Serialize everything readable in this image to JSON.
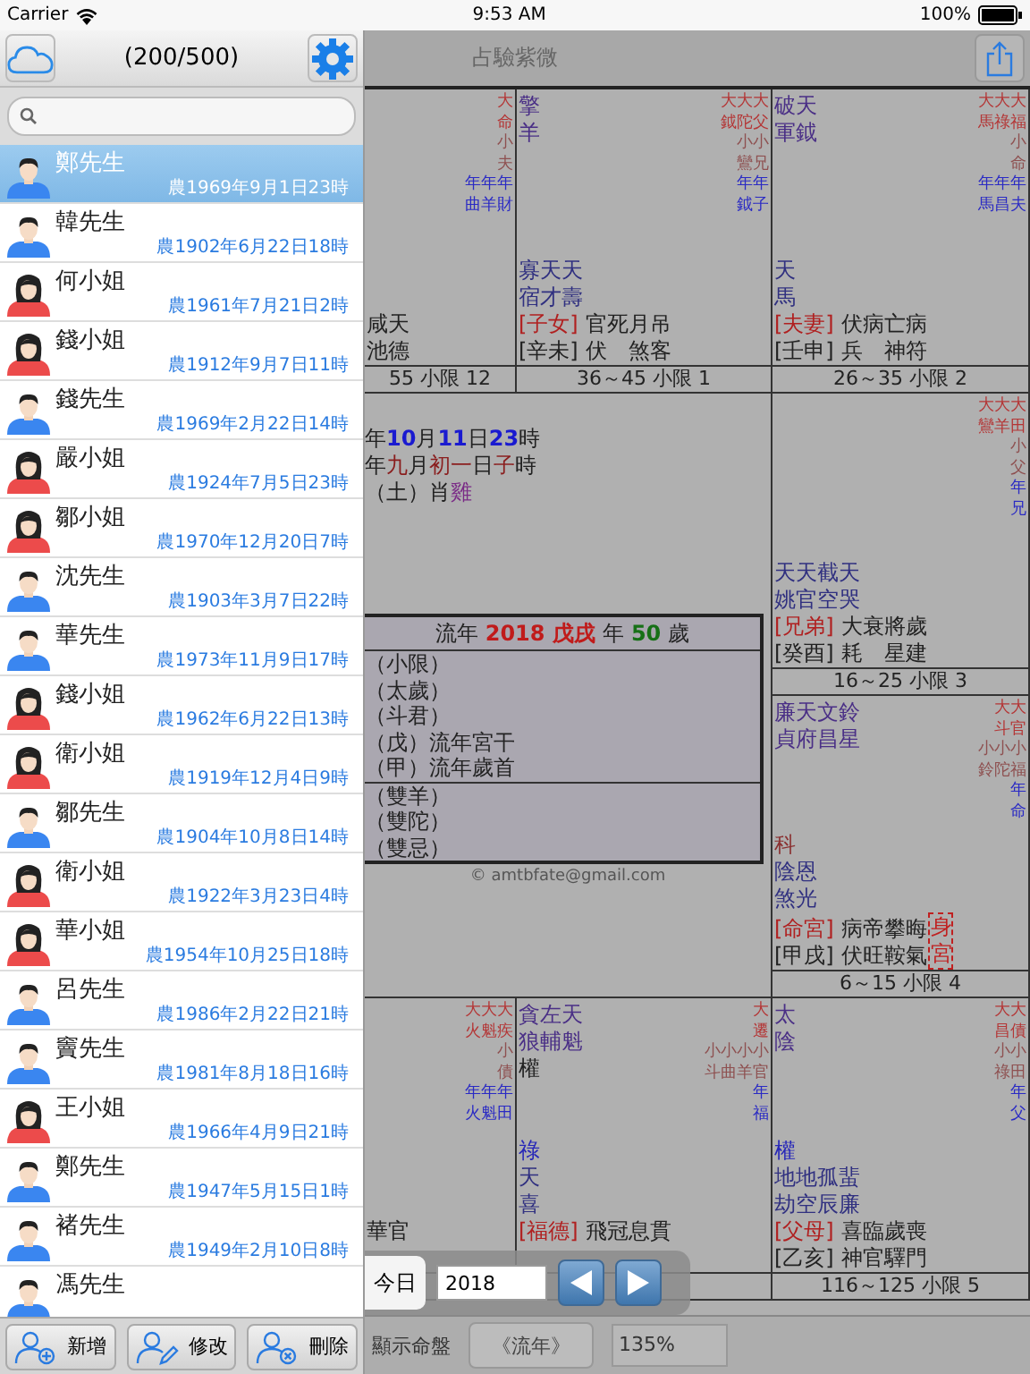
{
  "status_bar": {
    "carrier": "Carrier",
    "time": "9:53 AM",
    "battery": "100%"
  },
  "sidebar": {
    "count": "(200/500)"
  },
  "people": [
    {
      "name": "鄭先生",
      "date": "農1969年9月1日23時",
      "kind": "male",
      "selected": true
    },
    {
      "name": "韓先生",
      "date": "農1902年6月22日18時",
      "kind": "male",
      "selected": false
    },
    {
      "name": "何小姐",
      "date": "農1961年7月21日2時",
      "kind": "female",
      "selected": false
    },
    {
      "name": "錢小姐",
      "date": "農1912年9月7日11時",
      "kind": "female",
      "selected": false
    },
    {
      "name": "錢先生",
      "date": "農1969年2月22日14時",
      "kind": "male",
      "selected": false
    },
    {
      "name": "嚴小姐",
      "date": "農1924年7月5日23時",
      "kind": "female",
      "selected": false
    },
    {
      "name": "鄒小姐",
      "date": "農1970年12月20日7時",
      "kind": "female",
      "selected": false
    },
    {
      "name": "沈先生",
      "date": "農1903年3月7日22時",
      "kind": "male",
      "selected": false
    },
    {
      "name": "華先生",
      "date": "農1973年11月9日17時",
      "kind": "male",
      "selected": false
    },
    {
      "name": "錢小姐",
      "date": "農1962年6月22日13時",
      "kind": "female",
      "selected": false
    },
    {
      "name": "衛小姐",
      "date": "農1919年12月4日9時",
      "kind": "female",
      "selected": false
    },
    {
      "name": "鄒先生",
      "date": "農1904年10月8日14時",
      "kind": "male",
      "selected": false
    },
    {
      "name": "衛小姐",
      "date": "農1922年3月23日4時",
      "kind": "female",
      "selected": false
    },
    {
      "name": "華小姐",
      "date": "農1954年10月25日18時",
      "kind": "female",
      "selected": false
    },
    {
      "name": "呂先生",
      "date": "農1986年2月22日21時",
      "kind": "male",
      "selected": false
    },
    {
      "name": "竇先生",
      "date": "農1981年8月18日16時",
      "kind": "male",
      "selected": false
    },
    {
      "name": "王小姐",
      "date": "農1966年4月9日21時",
      "kind": "female",
      "selected": false
    },
    {
      "name": "鄭先生",
      "date": "農1947年5月15日1時",
      "kind": "male",
      "selected": false
    },
    {
      "name": "褚先生",
      "date": "農1949年2月10日8時",
      "kind": "male",
      "selected": false
    },
    {
      "name": "馮先生",
      "kind": "male",
      "selected": false
    }
  ],
  "list_buttons": [
    {
      "label": "新增",
      "kind": "add"
    },
    {
      "label": "修改",
      "kind": "edit"
    },
    {
      "label": "刪除",
      "kind": "delete"
    }
  ],
  "chart": {
    "title": "占驗紫微",
    "cells": [
      {
        "annotations": [
          {
            "text": "大",
            "kind": "da"
          },
          {
            "text": "命",
            "kind": "da"
          },
          {
            "text": "小",
            "kind": "xiao"
          },
          {
            "text": "夫",
            "kind": "xiao"
          },
          {
            "text": "年年年",
            "kind": "nian"
          },
          {
            "text": "曲羊財",
            "kind": "nian"
          }
        ],
        "palace": {
          "stars": "咸天"
        },
        "stem": {
          "stars": "池德"
        },
        "footer": "55 小限 12"
      },
      {
        "main": [
          {
            "text": "擎",
            "kind": "major"
          },
          {
            "text": "羊",
            "kind": "major"
          }
        ],
        "annotations": [
          {
            "text": "大大大",
            "kind": "da"
          },
          {
            "text": "鉞陀父",
            "kind": "da"
          },
          {
            "text": "小小",
            "kind": "xiao"
          },
          {
            "text": "鸞兄",
            "kind": "xiao"
          },
          {
            "text": "年年",
            "kind": "nian"
          },
          {
            "text": "鉞子",
            "kind": "nian"
          }
        ],
        "lines": [
          {
            "text": "寡天天",
            "kind": "minor"
          },
          {
            "text": "宿才壽",
            "kind": "minor"
          }
        ],
        "palace": {
          "label": "[子女]",
          "stars": "官死月吊"
        },
        "stem": {
          "label": "[辛未]",
          "stars": "伏　煞客"
        },
        "footer": "36～45 小限 1"
      },
      {
        "main": [
          {
            "text": "破天",
            "kind": "major"
          },
          {
            "text": "軍鉞",
            "kind": "major"
          }
        ],
        "annotations": [
          {
            "text": "大大大",
            "kind": "da"
          },
          {
            "text": "馬祿福",
            "kind": "da"
          },
          {
            "text": "小",
            "kind": "xiao"
          },
          {
            "text": "命",
            "kind": "xiao"
          },
          {
            "text": "年年年",
            "kind": "nian"
          },
          {
            "text": "馬昌夫",
            "kind": "nian"
          }
        ],
        "lines": [
          {
            "text": "天",
            "kind": "minor"
          },
          {
            "text": "馬",
            "kind": "minor"
          }
        ],
        "palace": {
          "label": "[夫妻]",
          "stars": "伏病亡病"
        },
        "stem": {
          "label": "[壬申]",
          "stars": "兵　神符"
        },
        "footer": "26～35 小限 2"
      },
      {
        "annotations": [
          {
            "text": "大大大",
            "kind": "da"
          },
          {
            "text": "鸞羊田",
            "kind": "da"
          },
          {
            "text": "小",
            "kind": "xiao"
          },
          {
            "text": "父",
            "kind": "xiao"
          },
          {
            "text": "年",
            "kind": "nian"
          },
          {
            "text": "兄",
            "kind": "nian"
          }
        ],
        "lines": [
          {
            "text": "天天截天",
            "kind": "minor"
          },
          {
            "text": "姚官空哭",
            "kind": "minor"
          }
        ],
        "palace": {
          "label": "[兄弟]",
          "stars": "大衰將歲"
        },
        "stem": {
          "label": "[癸酉]",
          "stars": "耗　星建"
        },
        "footer": "16～25 小限 3"
      },
      {
        "main": [
          {
            "text": "廉天文鈴",
            "kind": "major"
          },
          {
            "text": "貞府昌星",
            "kind": "major"
          }
        ],
        "annotations": [
          {
            "text": "大大",
            "kind": "da"
          },
          {
            "text": "斗官",
            "kind": "da"
          },
          {
            "text": "小小小",
            "kind": "xiao"
          },
          {
            "text": "鈴陀福",
            "kind": "xiao"
          },
          {
            "text": "年",
            "kind": "nian"
          },
          {
            "text": "命",
            "kind": "nian"
          }
        ],
        "lines": [
          {
            "text": "科",
            "kind": "ke"
          },
          {
            "text": "陰恩",
            "kind": "minor"
          },
          {
            "text": "煞光",
            "kind": "minor"
          }
        ],
        "palace": {
          "label": "[命宮]",
          "stars": "病帝攀晦"
        },
        "stem": {
          "label": "[甲戌]",
          "stars": "伏旺鞍氣"
        },
        "body_mark": "身宮",
        "footer": "6～15 小限 4"
      },
      {
        "annotations": [
          {
            "text": "大大大",
            "kind": "da"
          },
          {
            "text": "火魁疾",
            "kind": "da"
          },
          {
            "text": "小",
            "kind": "xiao"
          },
          {
            "text": "債",
            "kind": "xiao"
          },
          {
            "text": "年年年",
            "kind": "nian"
          },
          {
            "text": "火魁田",
            "kind": "nian"
          }
        ],
        "palace": {
          "stars": "華官"
        }
      },
      {
        "main": [
          {
            "text": "貪左天",
            "kind": "major"
          },
          {
            "text": "狼輔魁",
            "kind": "major"
          },
          {
            "text": "權",
            "kind": "quan"
          }
        ],
        "annotations": [
          {
            "text": "大",
            "kind": "da"
          },
          {
            "text": "遷",
            "kind": "da"
          },
          {
            "text": "小小小小",
            "kind": "xiao"
          },
          {
            "text": "斗曲羊官",
            "kind": "xiao"
          },
          {
            "text": "年",
            "kind": "nian"
          },
          {
            "text": "福",
            "kind": "nian"
          }
        ],
        "lines": [
          {
            "text": "祿",
            "kind": "lu"
          },
          {
            "text": "天",
            "kind": "minor"
          },
          {
            "text": "喜",
            "kind": "minor"
          }
        ],
        "palace": {
          "label": "[福德]",
          "stars": "飛冠息貫"
        }
      },
      {
        "main": [
          {
            "text": "太",
            "kind": "major"
          },
          {
            "text": "陰",
            "kind": "major"
          }
        ],
        "annotations": [
          {
            "text": "大大",
            "kind": "da"
          },
          {
            "text": "昌債",
            "kind": "da"
          },
          {
            "text": "小小",
            "kind": "xiao"
          },
          {
            "text": "祿田",
            "kind": "xiao"
          },
          {
            "text": "年",
            "kind": "nian"
          },
          {
            "text": "父",
            "kind": "nian"
          }
        ],
        "lines": [
          {
            "text": "權",
            "kind": "lu"
          },
          {
            "text": "地地孤蜚",
            "kind": "minor"
          },
          {
            "text": "劫空辰廉",
            "kind": "minor"
          }
        ],
        "palace": {
          "label": "[父母]",
          "stars": "喜臨歲喪"
        },
        "stem": {
          "label": "[乙亥]",
          "stars": "神官驛門"
        },
        "footer": "116～125 小限 5"
      }
    ],
    "center": {
      "info": [
        [
          {
            "text": "年",
            "kind": "plain"
          },
          {
            "text": "10",
            "kind": "num"
          },
          {
            "text": "月",
            "kind": "plain"
          },
          {
            "text": "11",
            "kind": "num"
          },
          {
            "text": "日",
            "kind": "plain"
          },
          {
            "text": "23",
            "kind": "num"
          },
          {
            "text": "時",
            "kind": "plain"
          }
        ],
        [
          {
            "text": "年",
            "kind": "plain"
          },
          {
            "text": "九",
            "kind": "lunar"
          },
          {
            "text": "月",
            "kind": "plain"
          },
          {
            "text": "初一",
            "kind": "lunar"
          },
          {
            "text": "日",
            "kind": "plain"
          },
          {
            "text": "子",
            "kind": "lunar"
          },
          {
            "text": "時",
            "kind": "plain"
          }
        ],
        [
          {
            "text": "（土）肖",
            "kind": "plain"
          },
          {
            "text": "雞",
            "kind": "zodiac"
          }
        ]
      ],
      "header": [
        {
          "text": "流年",
          "kind": "plain"
        },
        {
          "text": "2018 戊戌",
          "kind": "year"
        },
        {
          "text": "年",
          "kind": "plain"
        },
        {
          "text": "50",
          "kind": "age"
        },
        {
          "text": "歲",
          "kind": "plain"
        }
      ],
      "groups": [
        [
          "（小限）",
          "（太歲）",
          "（斗君）",
          "（戊）流年宮干",
          "（甲）流年歲首"
        ],
        [
          "（雙羊）",
          "（雙陀）",
          "（雙忌）"
        ]
      ],
      "credit": "© amtbfate@gmail.com"
    }
  },
  "popover": {
    "today": "今日",
    "year": "2018"
  },
  "bottom_bar": {
    "show_label": "顯示命盤",
    "mode": "《流年》",
    "zoom": "135%"
  }
}
